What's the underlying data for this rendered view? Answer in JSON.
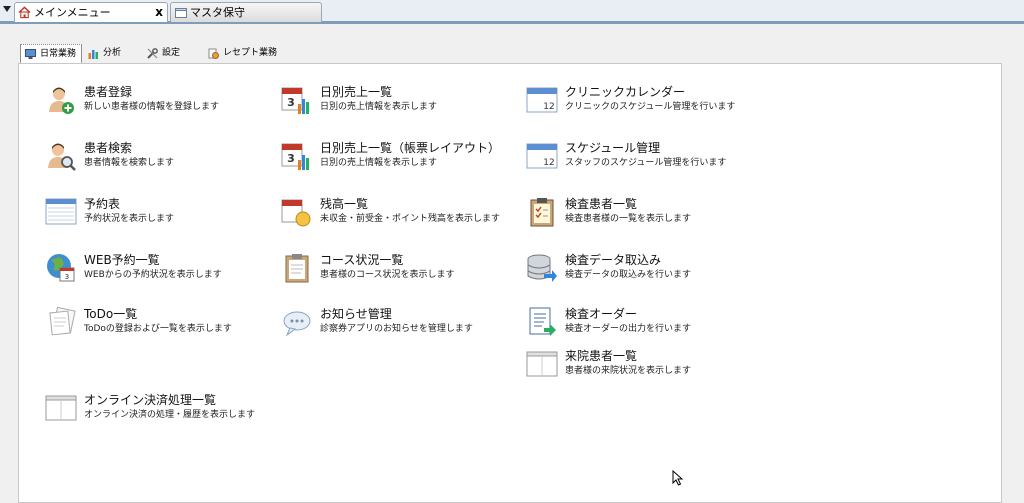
{
  "window_tabs": [
    {
      "label": "メインメニュー",
      "close": "x",
      "icon": "home-icon"
    },
    {
      "label": "マスタ保守",
      "icon": "folder-icon"
    }
  ],
  "sub_tabs": [
    {
      "label": "日常業務",
      "icon": "monitor-icon"
    },
    {
      "label": "分析",
      "icon": "bar-chart-icon"
    },
    {
      "label": "設定",
      "icon": "tools-icon"
    },
    {
      "label": "レセプト業務",
      "icon": "receipt-icon"
    }
  ],
  "menu": {
    "patient_register": {
      "title": "患者登録",
      "desc": "新しい患者様の情報を登録します"
    },
    "patient_search": {
      "title": "患者検索",
      "desc": "患者情報を検索します"
    },
    "reservation_table": {
      "title": "予約表",
      "desc": "予約状況を表示します"
    },
    "web_reservation": {
      "title": "WEB予約一覧",
      "desc": "WEBからの予約状況を表示します"
    },
    "todo": {
      "title": "ToDo一覧",
      "desc": "ToDoの登録および一覧を表示します"
    },
    "online_payment": {
      "title": "オンライン決済処理一覧",
      "desc": "オンライン決済の処理・履歴を表示します"
    },
    "daily_sales": {
      "title": "日別売上一覧",
      "desc": "日別の売上情報を表示します"
    },
    "daily_sales_form": {
      "title": "日別売上一覧（帳票レイアウト）",
      "desc": "日別の売上情報を表示します"
    },
    "balance": {
      "title": "残高一覧",
      "desc": "未収金・前受金・ポイント残高を表示します"
    },
    "course_status": {
      "title": "コース状況一覧",
      "desc": "患者様のコース状況を表示します"
    },
    "notice": {
      "title": "お知らせ管理",
      "desc": "診察券アプリのお知らせを管理します"
    },
    "clinic_calendar": {
      "title": "クリニックカレンダー",
      "desc": "クリニックのスケジュール管理を行います"
    },
    "schedule": {
      "title": "スケジュール管理",
      "desc": "スタッフのスケジュール管理を行います"
    },
    "exam_patients": {
      "title": "検査患者一覧",
      "desc": "検査患者様の一覧を表示します"
    },
    "exam_import": {
      "title": "検査データ取込み",
      "desc": "検査データの取込みを行います"
    },
    "exam_order": {
      "title": "検査オーダー",
      "desc": "検査オーダーの出力を行います"
    },
    "visit_patients": {
      "title": "来院患者一覧",
      "desc": "患者様の来院状況を表示します"
    }
  },
  "calendar_numbers": {
    "cal1": "3",
    "cal2": "3",
    "cal3": "3",
    "cal4": "12",
    "cal5": "12"
  }
}
